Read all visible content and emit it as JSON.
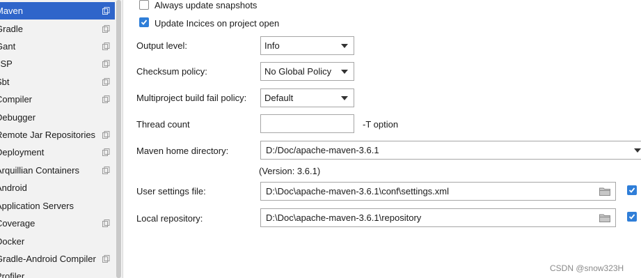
{
  "sidebar": {
    "items": [
      {
        "label": "Maven",
        "selected": true,
        "copy": true
      },
      {
        "label": "Gradle",
        "copy": true
      },
      {
        "label": "Gant",
        "copy": true
      },
      {
        "label": "JSP",
        "copy": true
      },
      {
        "label": "Sbt",
        "copy": true
      },
      {
        "label": "Compiler",
        "copy": true
      },
      {
        "label": "Debugger",
        "copy": false
      },
      {
        "label": "Remote Jar Repositories",
        "copy": true
      },
      {
        "label": "Deployment",
        "copy": true
      },
      {
        "label": "Arquillian Containers",
        "copy": true
      },
      {
        "label": "Android",
        "copy": false
      },
      {
        "label": "Application Servers",
        "copy": false
      },
      {
        "label": "Coverage",
        "copy": true
      },
      {
        "label": "Docker",
        "copy": false
      },
      {
        "label": "Gradle-Android Compiler",
        "copy": true
      },
      {
        "label": "Profiler",
        "copy": false
      }
    ]
  },
  "settings": {
    "always_update_snapshots": {
      "label": "Always update snapshots",
      "checked": false
    },
    "update_indices": {
      "label": "Update Incices on project open",
      "checked": true
    },
    "output_level": {
      "label": "Output level:",
      "value": "Info"
    },
    "checksum_policy": {
      "label": "Checksum policy:",
      "value": "No Global Policy"
    },
    "multiproject_fail_policy": {
      "label": "Multiproject build fail policy:",
      "value": "Default"
    },
    "thread_count": {
      "label": "Thread count",
      "value": "",
      "suffix": "-T option"
    },
    "maven_home": {
      "label": "Maven home directory:",
      "value": "D:/Doc/apache-maven-3.6.1",
      "version": "(Version: 3.6.1)"
    },
    "user_settings_file": {
      "label": "User settings file:",
      "value": "D:\\Doc\\apache-maven-3.6.1\\conf\\settings.xml",
      "override": true
    },
    "local_repository": {
      "label": "Local repository:",
      "value": "D:\\Doc\\apache-maven-3.6.1\\repository",
      "override": true
    }
  },
  "watermark": "CSDN @snow323H"
}
